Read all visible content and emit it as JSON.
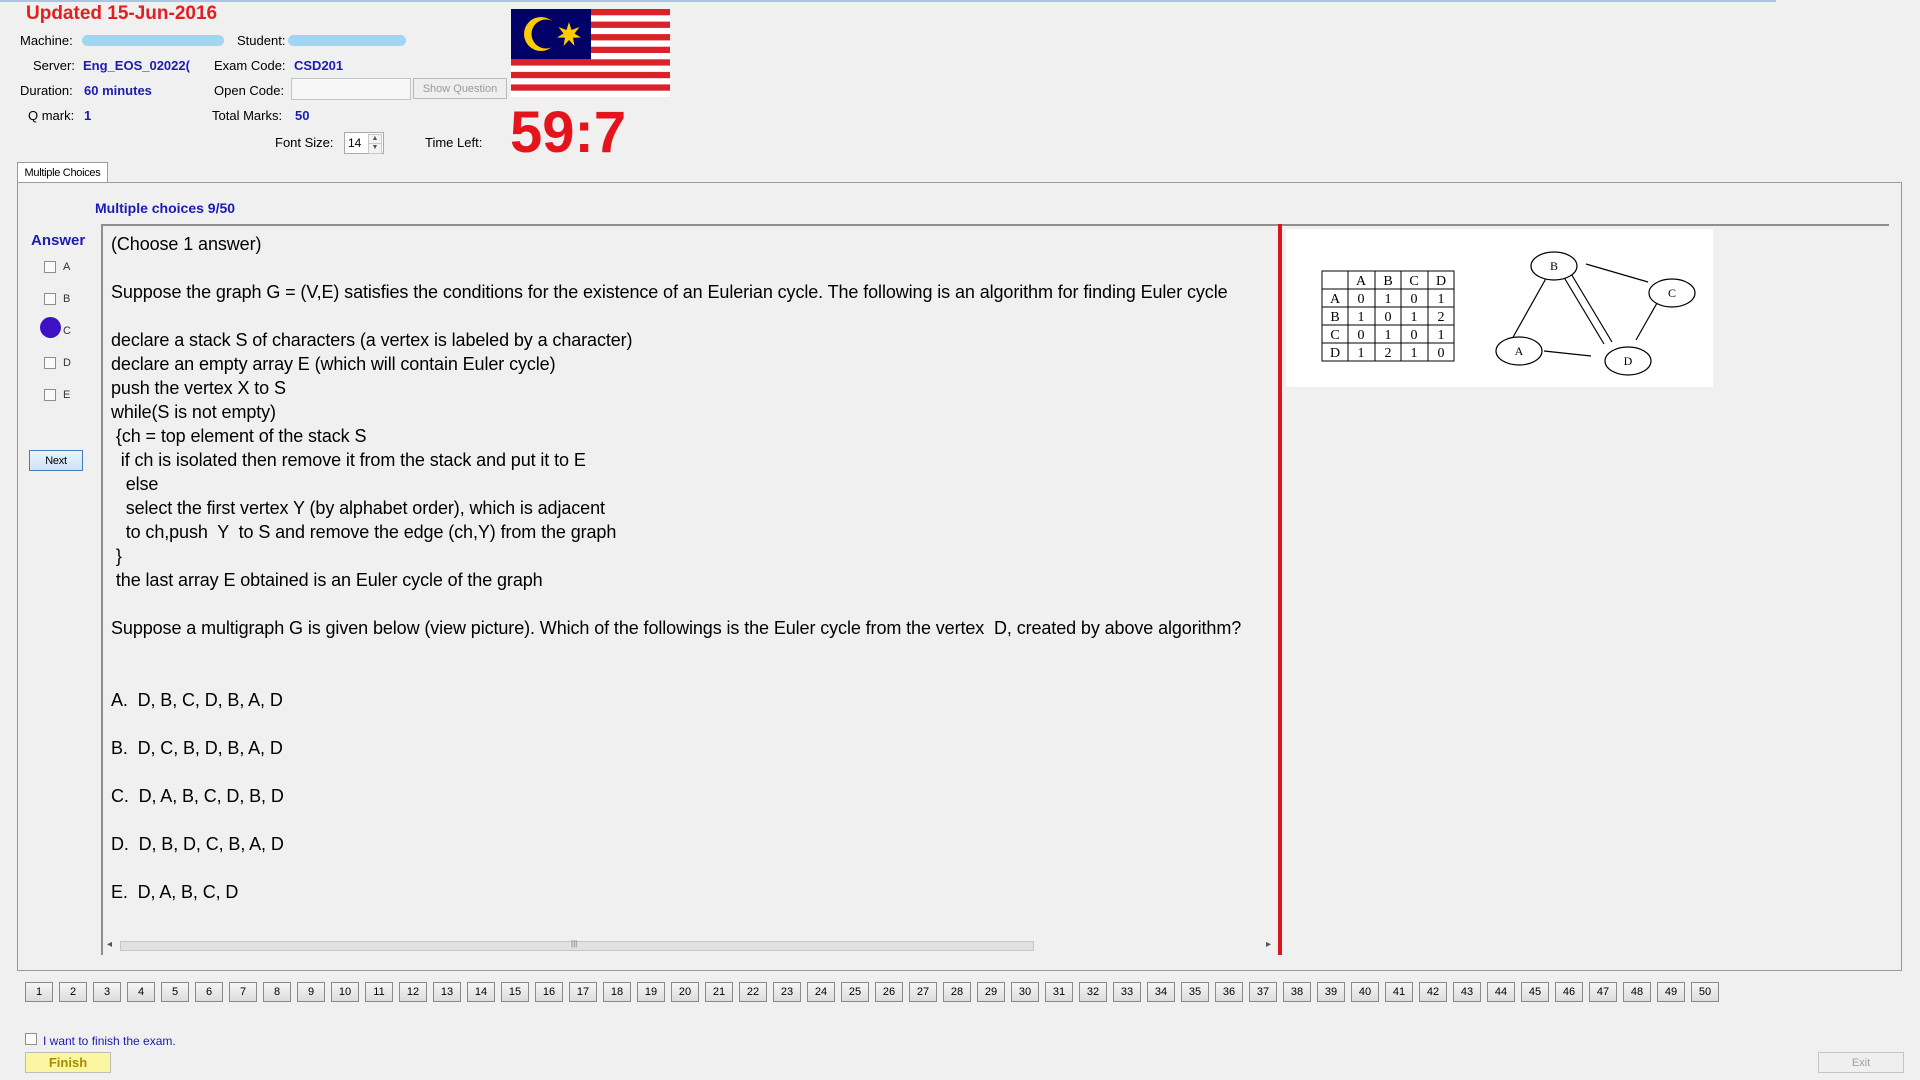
{
  "header": {
    "updated": "Updated 15-Jun-2016",
    "machine_label": "Machine:",
    "student_label": "Student:",
    "server_label": "Server:",
    "server_value": "Eng_EOS_02022(",
    "exam_code_label": "Exam Code:",
    "exam_code_value": "CSD201",
    "duration_label": "Duration:",
    "duration_value": "60 minutes",
    "open_code_label": "Open Code:",
    "show_question_label": "Show Question",
    "qmark_label": "Q mark:",
    "qmark_value": "1",
    "total_marks_label": "Total Marks:",
    "total_marks_value": "50",
    "font_size_label": "Font Size:",
    "font_size_value": "14",
    "time_left_label": "Time Left:",
    "time_left_value": "59:7"
  },
  "tab": {
    "label": "Multiple Choices"
  },
  "question": {
    "header": "Multiple choices 9/50",
    "text": "(Choose 1 answer)\n\nSuppose the graph G = (V,E) satisfies the conditions for the existence of an Eulerian cycle. The following is an algorithm for finding Euler cycle\n\ndeclare a stack S of characters (a vertex is labeled by a character)\ndeclare an empty array E (which will contain Euler cycle)\npush the vertex X to S\nwhile(S is not empty)\n {ch = top element of the stack S\n  if ch is isolated then remove it from the stack and put it to E\n   else\n   select the first vertex Y (by alphabet order), which is adjacent\n   to ch,push  Y  to S and remove the edge (ch,Y) from the graph\n }\n the last array E obtained is an Euler cycle of the graph\n\nSuppose a multigraph G is given below (view picture). Which of the followings is the Euler cycle from the vertex  D, created by above algorithm?\n\n\nA.  D, B, C, D, B, A, D\n\nB.  D, C, B, D, B, A, D\n\nC.  D, A, B, C, D, B, D\n\nD.  D, B, D, C, B, A, D\n\nE.  D, A, B, C, D"
  },
  "answer": {
    "header": "Answer",
    "options": [
      "A",
      "B",
      "C",
      "D",
      "E"
    ],
    "selected": "C",
    "next_label": "Next"
  },
  "matrix": {
    "cols": [
      "A",
      "B",
      "C",
      "D"
    ],
    "rows": [
      {
        "label": "A",
        "cells": [
          "0",
          "1",
          "0",
          "1"
        ]
      },
      {
        "label": "B",
        "cells": [
          "1",
          "0",
          "1",
          "2"
        ]
      },
      {
        "label": "C",
        "cells": [
          "0",
          "1",
          "0",
          "1"
        ]
      },
      {
        "label": "D",
        "cells": [
          "1",
          "2",
          "1",
          "0"
        ]
      }
    ]
  },
  "graph": {
    "nodes": [
      "B",
      "C",
      "A",
      "D"
    ]
  },
  "nav": {
    "questions": [
      "1",
      "2",
      "3",
      "4",
      "5",
      "6",
      "7",
      "8",
      "9",
      "10",
      "11",
      "12",
      "13",
      "14",
      "15",
      "16",
      "17",
      "18",
      "19",
      "20",
      "21",
      "22",
      "23",
      "24",
      "25",
      "26",
      "27",
      "28",
      "29",
      "30",
      "31",
      "32",
      "33",
      "34",
      "35",
      "36",
      "37",
      "38",
      "39",
      "40",
      "41",
      "42",
      "43",
      "44",
      "45",
      "46",
      "47",
      "48",
      "49",
      "50"
    ]
  },
  "footer": {
    "finish_checkbox_label": "I want to finish the exam.",
    "finish_label": "Finish",
    "exit_label": "Exit"
  },
  "colors": {
    "accent_blue": "#1b1bb5",
    "timer_red": "#e3141b",
    "divider_red": "#d8171d",
    "selected_radio": "#3d12c4"
  },
  "icons": [
    "malaysia-flag-icon",
    "spin-up-icon",
    "spin-down-icon",
    "scroll-left-icon",
    "scroll-right-icon"
  ]
}
